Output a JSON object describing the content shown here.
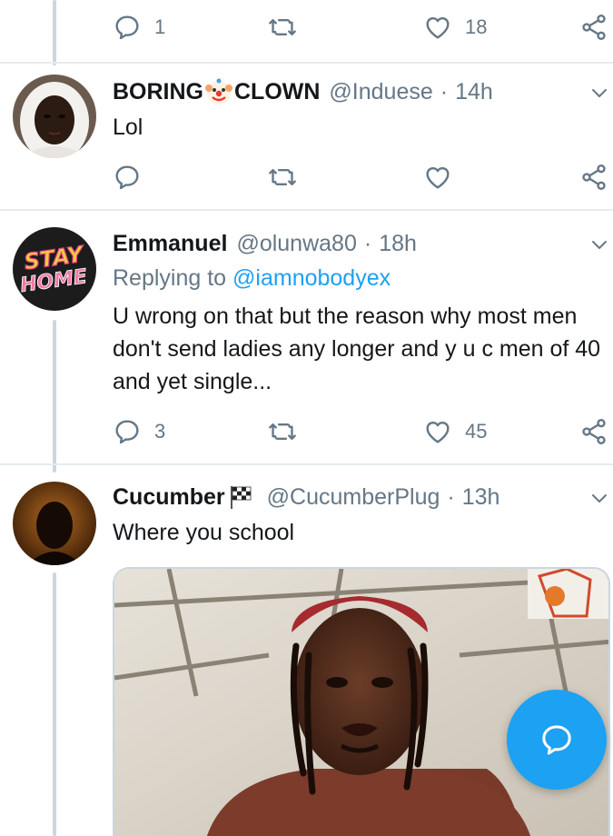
{
  "colors": {
    "accent": "#1da1f2",
    "muted": "#657786",
    "text": "#14171a",
    "divider": "#e6ecf0"
  },
  "top_actions": {
    "reply_count": "1",
    "retweet_count": "",
    "like_count": "18"
  },
  "tweets": [
    {
      "name": "BORING",
      "name_emoji": "clown-face-emoji",
      "name_suffix": "CLOWN",
      "handle": "@Induese",
      "dot": "·",
      "time": "14h",
      "text": "Lol",
      "reply_count": "",
      "like_count": ""
    },
    {
      "name": "Emmanuel",
      "handle": "@olunwa80",
      "dot": "·",
      "time": "18h",
      "replying_prefix": "Replying to ",
      "replying_to": "@iamnobodyex",
      "text": "U wrong on that but the reason why most men don't send ladies any longer and y u c men of 40 and yet single...",
      "avatar_text_1": "STAY",
      "avatar_text_2": "HOME",
      "reply_count": "3",
      "like_count": "45"
    },
    {
      "name": "Cucumber",
      "name_emoji": "chequered-flag-emoji",
      "handle": "@CucumberPlug",
      "dot": "·",
      "time": "13h",
      "text": "Where you school"
    }
  ],
  "fab": {
    "icon": "compose-reply-icon"
  }
}
